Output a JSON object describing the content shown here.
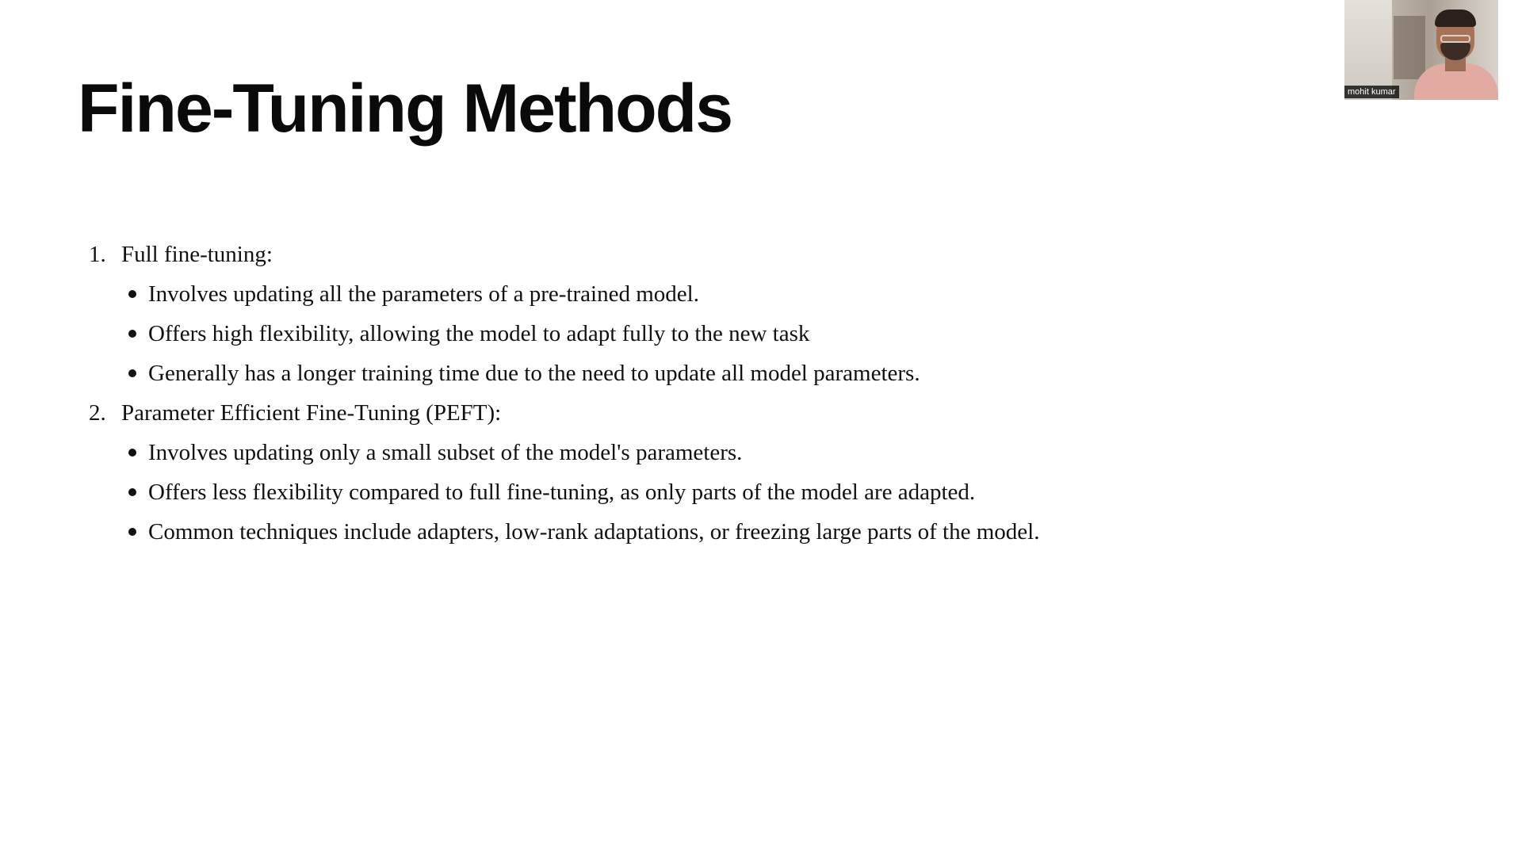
{
  "slide": {
    "title": "Fine-Tuning Methods",
    "sections": [
      {
        "number": "1.",
        "heading": "Full fine-tuning:",
        "bullets": [
          "Involves updating all the parameters of a pre-trained model.",
          "Offers high flexibility, allowing the model to adapt fully to the new task",
          "Generally has a longer training time due to the need to update all model parameters."
        ]
      },
      {
        "number": "2.",
        "heading": "Parameter Efficient Fine-Tuning (PEFT):",
        "bullets": [
          "Involves updating only a small subset of the model's parameters.",
          "Offers less flexibility compared to full fine-tuning, as only parts of the model are adapted.",
          "Common techniques include adapters, low-rank adaptations, or freezing large parts of the model."
        ]
      }
    ]
  },
  "webcam": {
    "participant_name": "mohit kumar"
  }
}
